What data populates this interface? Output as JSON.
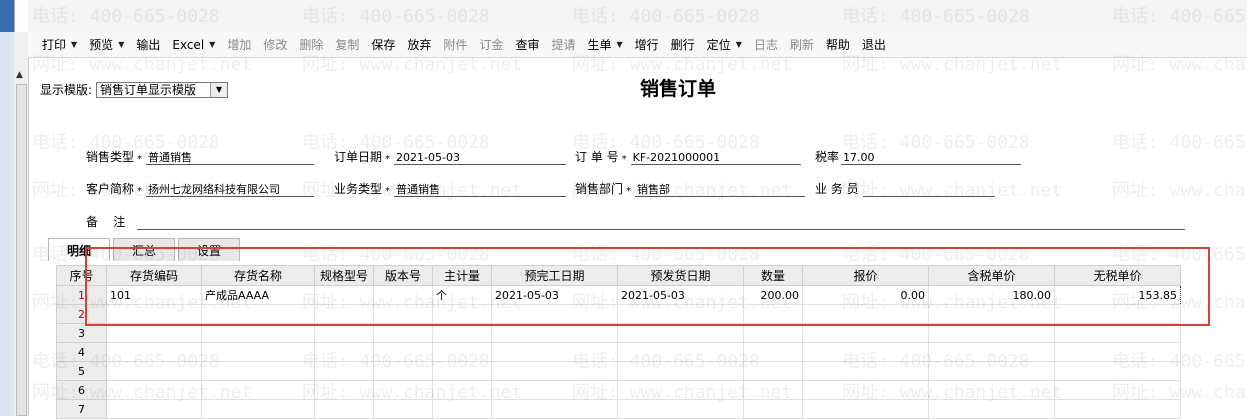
{
  "toolbar": [
    {
      "label": "打印",
      "dropdown": true,
      "disabled": false
    },
    {
      "label": "预览",
      "dropdown": true,
      "disabled": false
    },
    {
      "label": "输出",
      "dropdown": false,
      "disabled": false
    },
    {
      "label": "Excel",
      "dropdown": true,
      "disabled": false
    },
    {
      "label": "增加",
      "dropdown": false,
      "disabled": true
    },
    {
      "label": "修改",
      "dropdown": false,
      "disabled": true
    },
    {
      "label": "删除",
      "dropdown": false,
      "disabled": true
    },
    {
      "label": "复制",
      "dropdown": false,
      "disabled": true
    },
    {
      "label": "保存",
      "dropdown": false,
      "disabled": false
    },
    {
      "label": "放弃",
      "dropdown": false,
      "disabled": false
    },
    {
      "label": "附件",
      "dropdown": false,
      "disabled": true
    },
    {
      "label": "订金",
      "dropdown": false,
      "disabled": true
    },
    {
      "label": "查审",
      "dropdown": false,
      "disabled": false
    },
    {
      "label": "提请",
      "dropdown": false,
      "disabled": true
    },
    {
      "label": "生单",
      "dropdown": true,
      "disabled": false
    },
    {
      "label": "增行",
      "dropdown": false,
      "disabled": false
    },
    {
      "label": "删行",
      "dropdown": false,
      "disabled": false
    },
    {
      "label": "定位",
      "dropdown": true,
      "disabled": false
    },
    {
      "label": "日志",
      "dropdown": false,
      "disabled": true
    },
    {
      "label": "刷新",
      "dropdown": false,
      "disabled": true
    },
    {
      "label": "帮助",
      "dropdown": false,
      "disabled": false
    },
    {
      "label": "退出",
      "dropdown": false,
      "disabled": false
    }
  ],
  "template": {
    "label": "显示模版:",
    "value": "销售订单显示模版"
  },
  "title": "销售订单",
  "header": {
    "sale_type": {
      "label": "销售类型",
      "value": "普通销售"
    },
    "order_date": {
      "label": "订单日期",
      "value": "2021-05-03"
    },
    "order_no": {
      "label": "订 单 号",
      "value": "KF-2021000001"
    },
    "tax_rate": {
      "label": "税率",
      "value": "17.00"
    },
    "customer": {
      "label": "客户简称",
      "value": "扬州七龙网络科技有限公司"
    },
    "biz_type": {
      "label": "业务类型",
      "value": "普通销售"
    },
    "dept": {
      "label": "销售部门",
      "value": "销售部"
    },
    "salesman": {
      "label": "业 务 员",
      "value": ""
    },
    "remark": {
      "label": "备    注",
      "value": ""
    }
  },
  "tabs": [
    {
      "label": "明细",
      "active": true
    },
    {
      "label": "汇总",
      "active": false
    },
    {
      "label": "设置",
      "active": false
    }
  ],
  "grid": {
    "row_header": "序号",
    "columns": [
      "存货编码",
      "存货名称",
      "规格型号",
      "版本号",
      "主计量",
      "预完工日期",
      "预发货日期",
      "数量",
      "报价",
      "含税单价",
      "无税单价"
    ],
    "rows": [
      {
        "no": "1",
        "cells": [
          "101",
          "产成品AAAA",
          "",
          "",
          "个",
          "2021-05-03",
          "2021-05-03",
          "200.00",
          "0.00",
          "180.00",
          "153.85"
        ]
      },
      {
        "no": "2",
        "cells": [
          "",
          "",
          "",
          "",
          "",
          "",
          "",
          "",
          "",
          "",
          ""
        ]
      },
      {
        "no": "3",
        "cells": [
          "",
          "",
          "",
          "",
          "",
          "",
          "",
          "",
          "",
          "",
          ""
        ]
      },
      {
        "no": "4",
        "cells": [
          "",
          "",
          "",
          "",
          "",
          "",
          "",
          "",
          "",
          "",
          ""
        ]
      },
      {
        "no": "5",
        "cells": [
          "",
          "",
          "",
          "",
          "",
          "",
          "",
          "",
          "",
          "",
          ""
        ]
      },
      {
        "no": "6",
        "cells": [
          "",
          "",
          "",
          "",
          "",
          "",
          "",
          "",
          "",
          "",
          ""
        ]
      },
      {
        "no": "7",
        "cells": [
          "",
          "",
          "",
          "",
          "",
          "",
          "",
          "",
          "",
          "",
          ""
        ]
      }
    ]
  },
  "watermark": {
    "phone": "电话: 400-665-0028",
    "site": "网址: www.chanjet.net"
  }
}
